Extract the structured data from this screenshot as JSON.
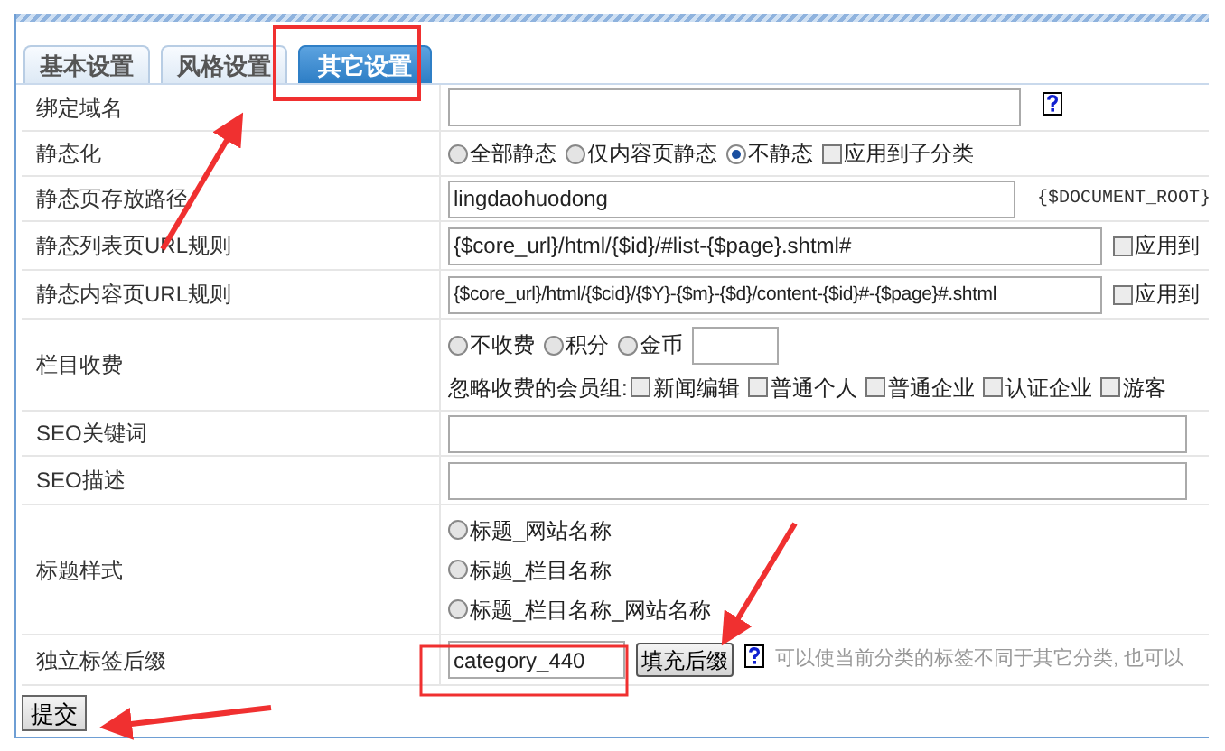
{
  "tabs": [
    {
      "label": "基本设置",
      "selected": false
    },
    {
      "label": "风格设置",
      "selected": false
    },
    {
      "label": "其它设置",
      "selected": true
    }
  ],
  "rows": [
    {
      "label": "绑定域名",
      "lines": [
        [
          {
            "kind": "input"
          },
          {
            "kind": "help"
          }
        ]
      ]
    },
    {
      "label": "静态化",
      "lines": [
        [
          {
            "kind": "radio",
            "label": "全部静态",
            "selected": false
          },
          {
            "kind": "radio",
            "label": "仅内容页静态",
            "selected": false
          },
          {
            "kind": "radio",
            "label": "不静态",
            "selected": true
          },
          {
            "kind": "checkbox",
            "label": "应用到子分类",
            "checked": false
          }
        ]
      ]
    },
    {
      "label": "静态页存放路径",
      "lines": [
        [
          {
            "kind": "input",
            "value": "lingdaohuodong"
          },
          {
            "kind": "code",
            "text": "{$DOCUMENT_ROOT}"
          }
        ]
      ]
    },
    {
      "label": "静态列表页URL规则",
      "lines": [
        [
          {
            "kind": "input",
            "value": "{$core_url}/html/{$id}/#list-{$page}.shtml#"
          },
          {
            "kind": "checkbox",
            "label": "应用到",
            "checked": false
          }
        ]
      ]
    },
    {
      "label": "静态内容页URL规则",
      "lines": [
        [
          {
            "kind": "input",
            "value": "{$core_url}/html/{$cid}/{$Y}-{$m}-{$d}/content-{$id}#-{$page}#.shtml"
          },
          {
            "kind": "checkbox",
            "label": "应用到",
            "checked": false
          }
        ]
      ]
    },
    {
      "label": "栏目收费",
      "lines": [
        [
          {
            "kind": "radio",
            "label": "不收费",
            "selected": false
          },
          {
            "kind": "radio",
            "label": "积分",
            "selected": false
          },
          {
            "kind": "radio",
            "label": "金币",
            "selected": false
          },
          {
            "kind": "input"
          }
        ],
        [
          {
            "kind": "text",
            "text": "忽略收费的会员组:"
          },
          {
            "kind": "checkbox",
            "label": "新闻编辑",
            "checked": false
          },
          {
            "kind": "checkbox",
            "label": "普通个人",
            "checked": false
          },
          {
            "kind": "checkbox",
            "label": "普通企业",
            "checked": false
          },
          {
            "kind": "checkbox",
            "label": "认证企业",
            "checked": false
          },
          {
            "kind": "checkbox",
            "label": "游客",
            "checked": false
          }
        ]
      ]
    },
    {
      "label": "SEO关键词",
      "lines": [
        [
          {
            "kind": "input"
          }
        ]
      ]
    },
    {
      "label": "SEO描述",
      "lines": [
        [
          {
            "kind": "input"
          }
        ]
      ]
    },
    {
      "label": "标题样式",
      "lines": [
        [
          {
            "kind": "radio",
            "label": "标题_网站名称",
            "selected": false
          }
        ],
        [
          {
            "kind": "radio",
            "label": "标题_栏目名称",
            "selected": false
          }
        ],
        [
          {
            "kind": "radio",
            "label": "标题_栏目名称_网站名称",
            "selected": false
          }
        ]
      ]
    },
    {
      "label": "独立标签后缀",
      "lines": [
        [
          {
            "kind": "input",
            "value": "category_440"
          },
          {
            "kind": "button",
            "label": "填充后缀"
          },
          {
            "kind": "help"
          },
          {
            "kind": "note",
            "text": "可以使当前分类的标签不同于其它分类, 也可以"
          }
        ]
      ]
    }
  ],
  "submit": "提交"
}
